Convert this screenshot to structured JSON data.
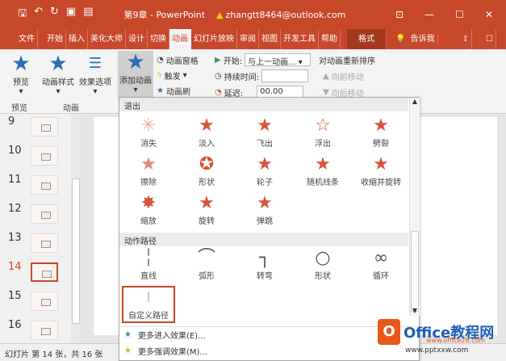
{
  "titlebar": {
    "quick_access": [
      "save-icon",
      "undo-icon",
      "redo-icon",
      "present-icon",
      "layout-icon"
    ],
    "title": "第9章 - PowerPoint",
    "account": "zhangtt8464@outlook.com",
    "ribbon_display_icon": "⊡",
    "minimize": "—",
    "maximize": "☐",
    "close": "✕"
  },
  "tabs": [
    "文件",
    "开始",
    "插入",
    "美化大师",
    "设计",
    "切换",
    "动画",
    "幻灯片放映",
    "审阅",
    "视图",
    "开发工具",
    "帮助"
  ],
  "format_tab": "格式",
  "tell_me": "告诉我",
  "active_tab": "动画",
  "ribbon": {
    "preview": "预览",
    "anim_style": "动画样式",
    "effect_options": "效果选项",
    "add_animation": "添加动画",
    "anim_pane": "动画窗格",
    "trigger": "触发",
    "anim_painter": "动画刷",
    "start_label": "开始:",
    "start_value": "与上一动画...",
    "duration_label": "持续时间:",
    "duration_value": "",
    "delay_label": "延迟:",
    "delay_value": "00.00",
    "reorder": "对动画重新排序",
    "move_earlier": "向前移动",
    "move_later": "向后移动",
    "group_preview": "预览",
    "group_animation": "动画"
  },
  "slides": [
    {
      "n": "9"
    },
    {
      "n": "10"
    },
    {
      "n": "11"
    },
    {
      "n": "12"
    },
    {
      "n": "13"
    },
    {
      "n": "14",
      "selected": true
    },
    {
      "n": "15"
    },
    {
      "n": "16"
    }
  ],
  "status": "幻灯片 第 14 张，共 16 张",
  "dropdown": {
    "exit_header": "退出",
    "exit_items": [
      "消失",
      "淡入",
      "飞出",
      "浮出",
      "劈裂",
      "擦除",
      "形状",
      "轮子",
      "随机线条",
      "收缩并旋转",
      "缩放",
      "旋转",
      "弹跳"
    ],
    "path_header": "动作路径",
    "path_items": [
      "直线",
      "弧形",
      "转弯",
      "形状",
      "循环",
      "自定义路径"
    ],
    "more_entrance": "更多进入效果(E)...",
    "more_emphasis": "更多强调效果(M)..."
  },
  "watermark": {
    "brand": "Office教程网",
    "url": "www.office26.com",
    "url2": "www.pptxxw.com"
  },
  "colors": {
    "accent": "#c7472b",
    "star": "#d9533a"
  }
}
